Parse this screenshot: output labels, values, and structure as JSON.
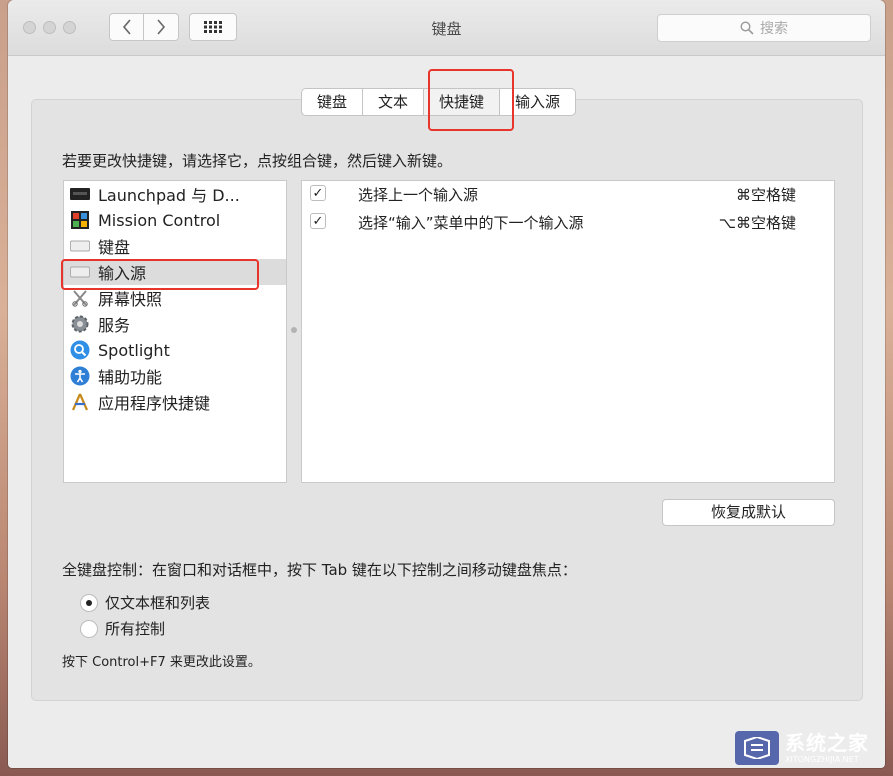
{
  "window": {
    "title": "键盘"
  },
  "search": {
    "placeholder": "搜索"
  },
  "tabs": [
    {
      "label": "键盘"
    },
    {
      "label": "文本"
    },
    {
      "label": "快捷键",
      "active": true
    },
    {
      "label": "输入源"
    }
  ],
  "instruction": "若要更改快捷键，请选择它，点按组合键，然后键入新键。",
  "categories": [
    {
      "label": "Launchpad 与 D...",
      "icon": "launchpad-icon"
    },
    {
      "label": "Mission Control",
      "icon": "mission-control-icon"
    },
    {
      "label": "键盘",
      "icon": "keyboard-icon"
    },
    {
      "label": "输入源",
      "icon": "input-source-icon",
      "selected": true
    },
    {
      "label": "屏幕快照",
      "icon": "screenshot-icon"
    },
    {
      "label": "服务",
      "icon": "gear-icon"
    },
    {
      "label": "Spotlight",
      "icon": "spotlight-icon"
    },
    {
      "label": "辅助功能",
      "icon": "accessibility-icon"
    },
    {
      "label": "应用程序快捷键",
      "icon": "app-shortcuts-icon"
    }
  ],
  "shortcuts": [
    {
      "checked": true,
      "name": "选择上一个输入源",
      "keys": "⌘空格键"
    },
    {
      "checked": true,
      "name": "选择“输入”菜单中的下一个输入源",
      "keys": "⌥⌘空格键"
    }
  ],
  "restore_button": "恢复成默认",
  "full_keyboard": {
    "label": "全键盘控制：在窗口和对话框中，按下 Tab 键在以下控制之间移动键盘焦点：",
    "options": [
      {
        "label": "仅文本框和列表",
        "selected": true
      },
      {
        "label": "所有控制",
        "selected": false
      }
    ],
    "note": "按下 Control+F7 来更改此设置。"
  },
  "watermark": {
    "main": "系统之家",
    "sub": "XITONGZHIJIA.NET"
  },
  "colors": {
    "highlight": "#e8352b",
    "selection": "#dcdcdc",
    "window_bg": "#ececec"
  }
}
